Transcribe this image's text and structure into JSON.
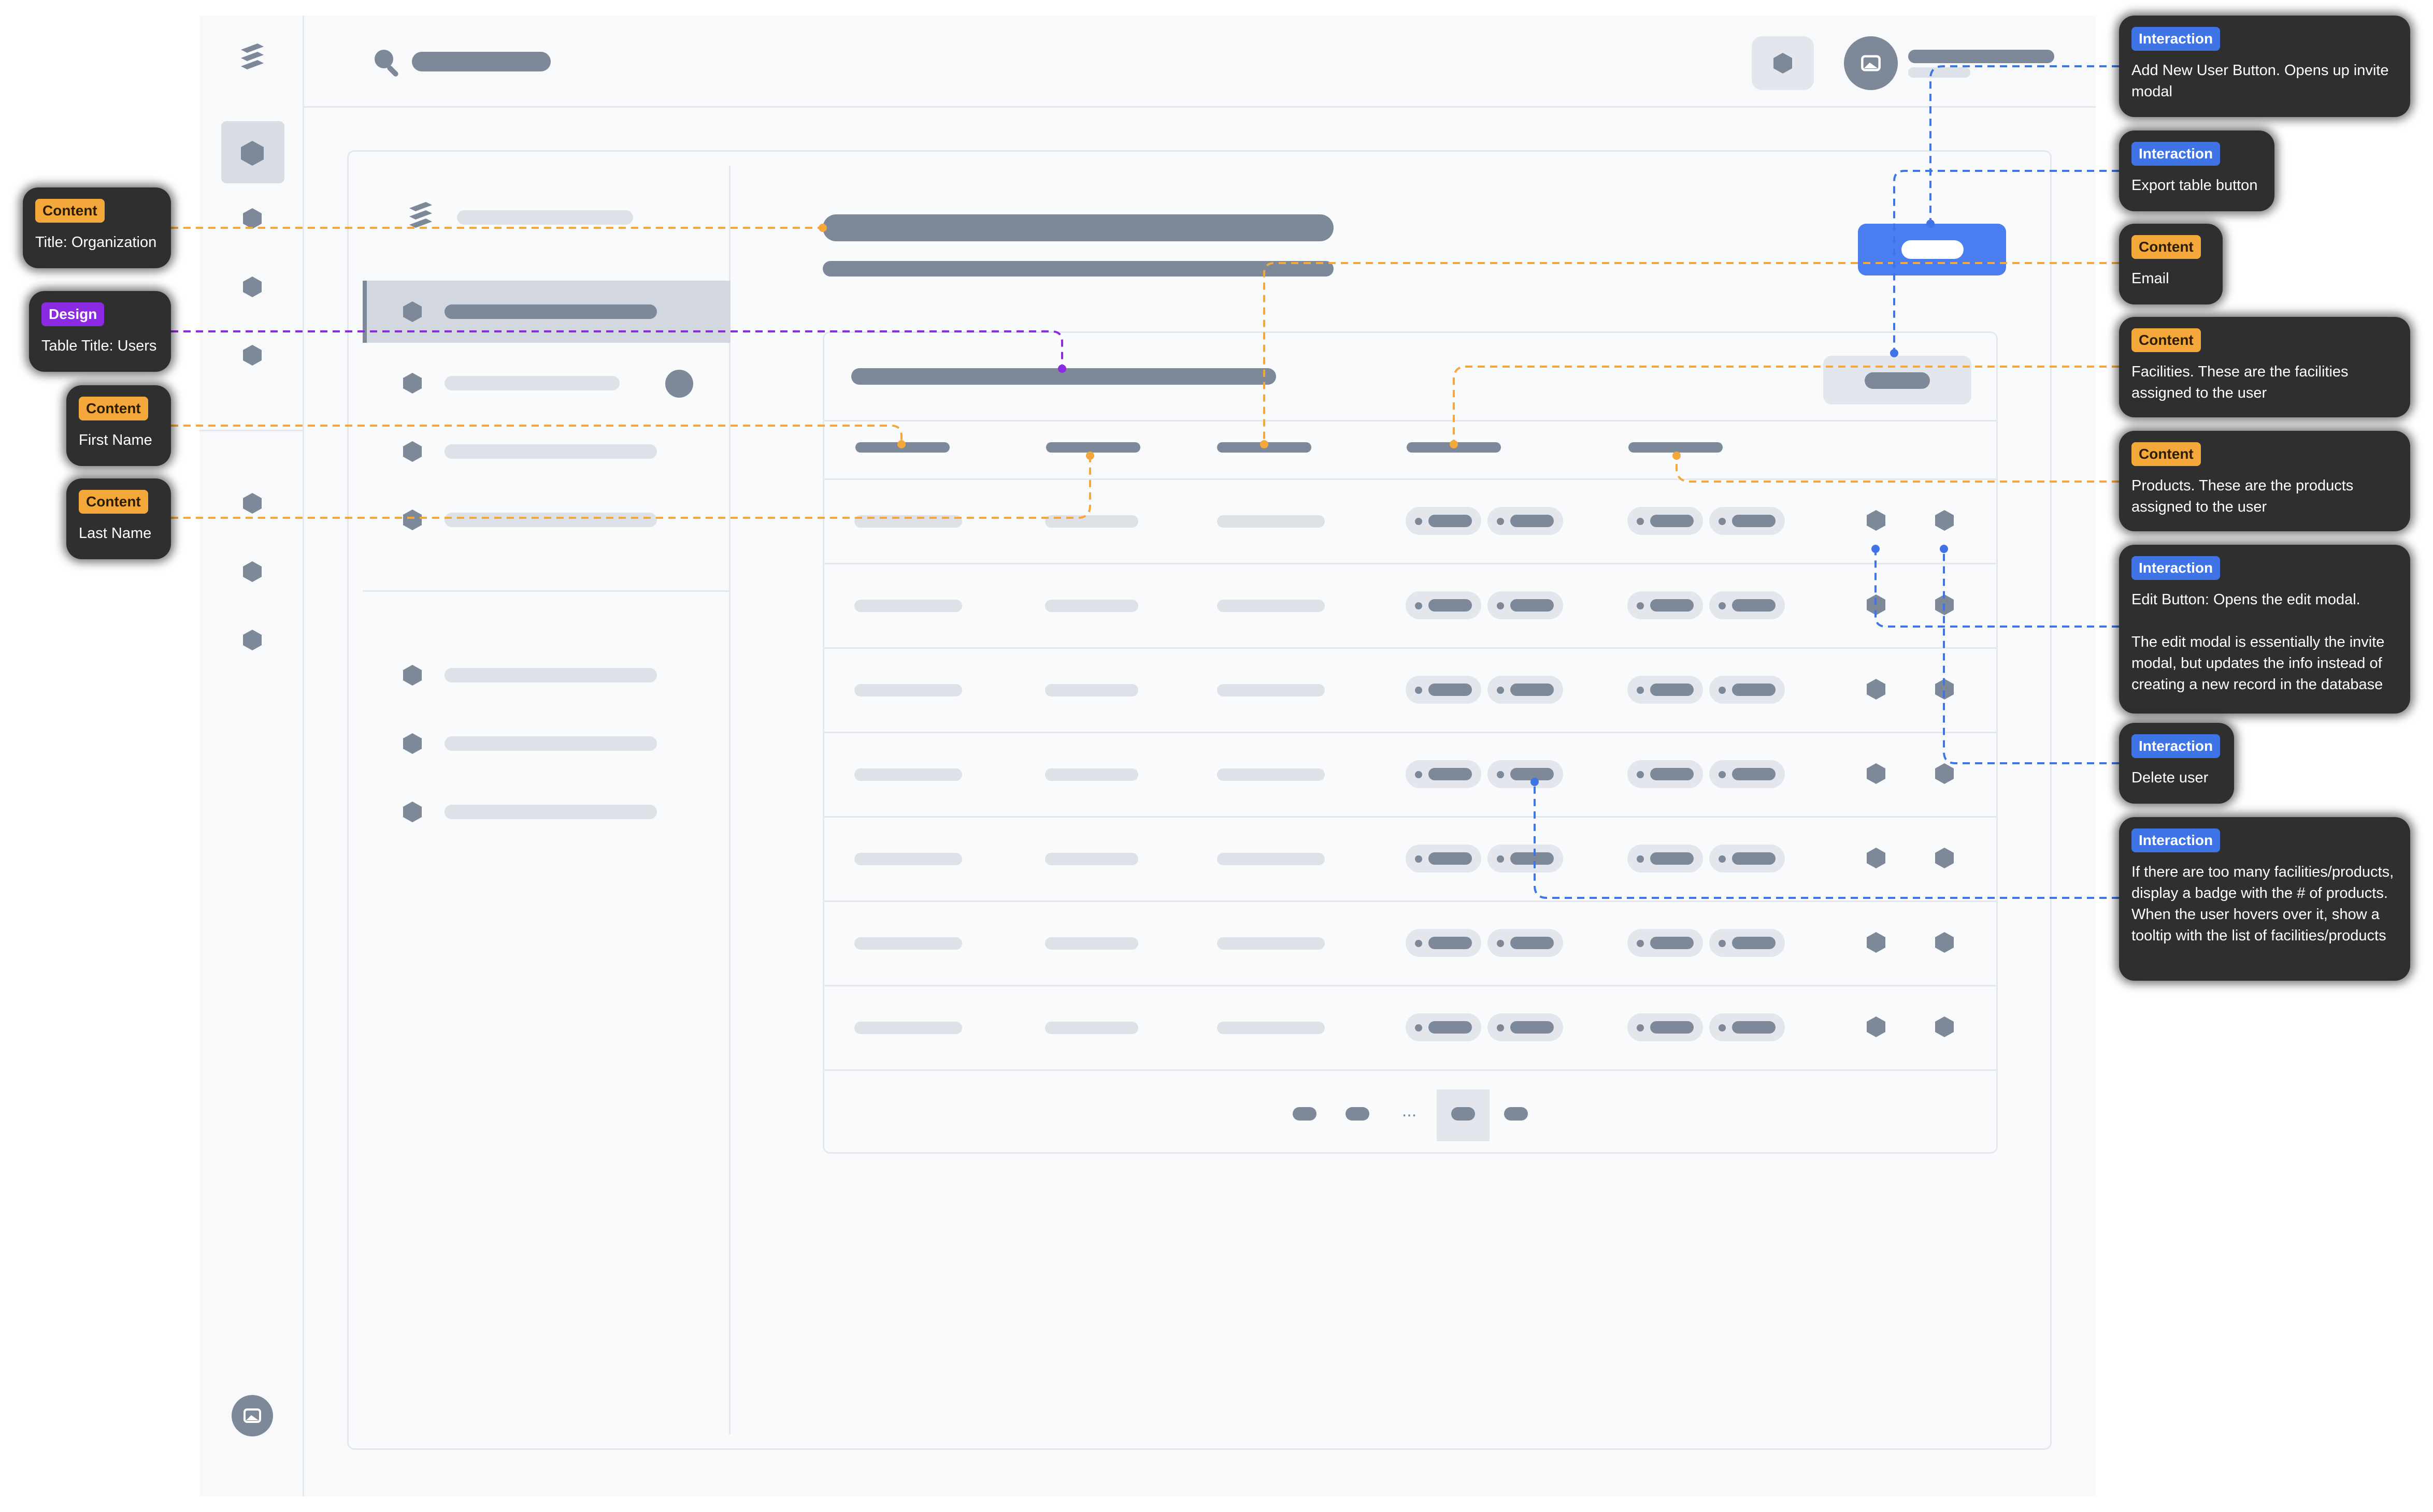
{
  "pagination": {
    "ellipsis": "..."
  },
  "annotations": {
    "left": [
      {
        "kind": "Content",
        "text": "Title: Organization"
      },
      {
        "kind": "Design",
        "text": "Table Title: Users"
      },
      {
        "kind": "Content",
        "text": "First Name"
      },
      {
        "kind": "Content",
        "text": "Last Name"
      }
    ],
    "right": [
      {
        "kind": "Interaction",
        "text": "Add New User Button. Opens up invite modal"
      },
      {
        "kind": "Interaction",
        "text": "Export table button"
      },
      {
        "kind": "Content",
        "text": "Email"
      },
      {
        "kind": "Content",
        "text": "Facilities. These are the facilities assigned to the user"
      },
      {
        "kind": "Content",
        "text": "Products. These are the products assigned to the user"
      },
      {
        "kind": "Interaction",
        "text": "Edit Button: Opens the edit modal.\n\nThe edit modal is essentially the invite modal, but updates the info instead of creating a new record in the database"
      },
      {
        "kind": "Interaction",
        "text": "Delete user"
      },
      {
        "kind": "Interaction",
        "text": "If there are too many facilities/products, display a badge with the # of products. When the user hovers over it, show a tooltip with the list of facilities/products"
      }
    ]
  },
  "icons": {
    "logo": "stack-logo-icon",
    "search": "search-icon",
    "nav": "hexagon-icon",
    "avatar": "image-avatar-icon",
    "edit": "hexagon-edit-icon",
    "delete": "hexagon-delete-icon"
  },
  "colors": {
    "wire": "#7d8899",
    "accent": "#4a7ef0",
    "content_annotation": "#f4a73b",
    "design_annotation": "#8a2be2",
    "interaction_annotation": "#3f74e6",
    "note_background": "#2f2f2f"
  }
}
